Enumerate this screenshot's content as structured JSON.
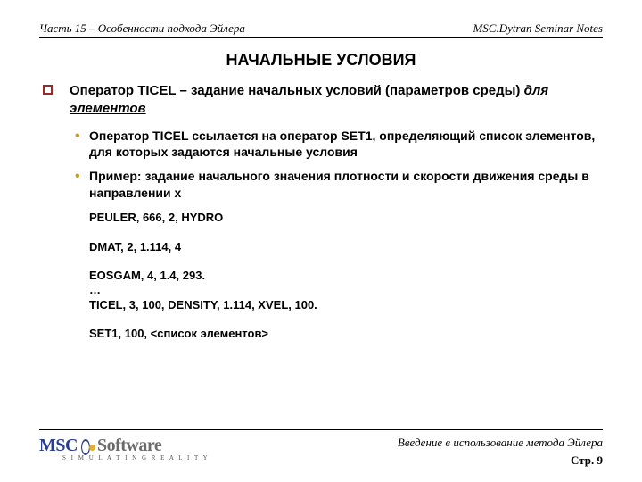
{
  "header": {
    "left": "Часть 15 – Особенности подхода Эйлера",
    "right": "MSC.Dytran Seminar Notes"
  },
  "title": "НАЧАЛЬНЫЕ УСЛОВИЯ",
  "bullet1": {
    "pre": "Оператор TICEL – задание начальных условий (параметров среды) ",
    "underlined": "для элементов"
  },
  "sub": {
    "a": "Оператор TICEL ссылается на оператор SET1, определяющий список элементов, для которых задаются начальные условия",
    "b": "Пример: задание начального значения плотности и скорости движения среды в направлении x"
  },
  "code": "PEULER, 666, 2, HYDRO\n\nDMAT, 2, 1.114, 4\n\nEOSGAM, 4, 1.4, 293.\n…\nTICEL, 3, 100, DENSITY, 1.114, XVEL, 100.\n\nSET1, 100, <список элементов>",
  "footer": {
    "intro": "Введение в использование метода Эйлера",
    "page_label": "Стр. ",
    "page_num": "9",
    "logo": {
      "msc": "MSC",
      "sw": "Software",
      "tag": "S I M U L A T I N G   R E A L I T Y"
    }
  }
}
